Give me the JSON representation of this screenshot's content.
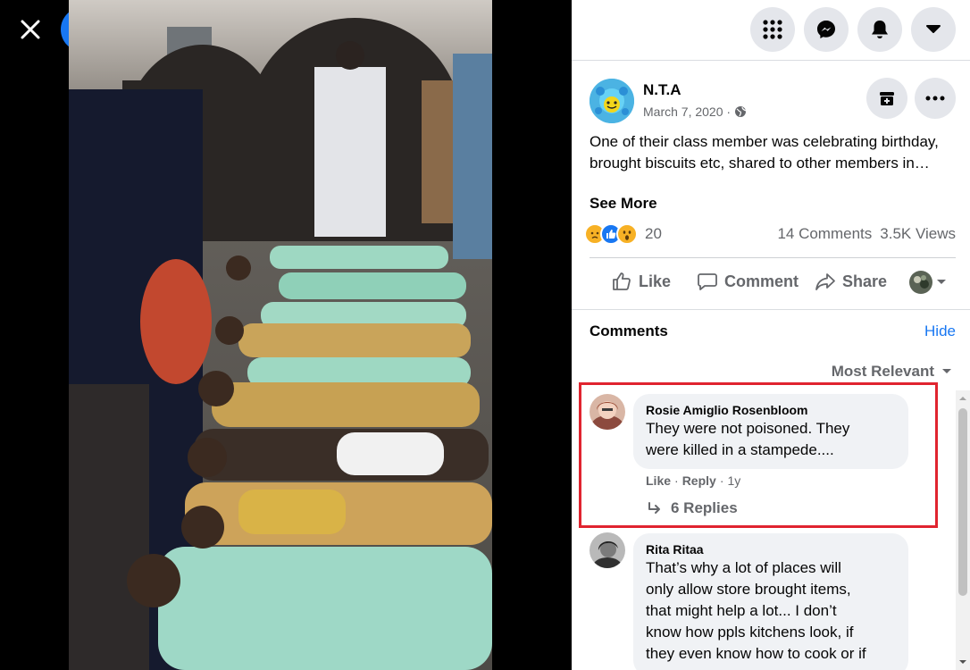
{
  "viewer": {
    "close_icon": "close-icon",
    "logo_icon": "facebook-logo-icon"
  },
  "topbar": {
    "buttons": [
      "apps-grid-icon",
      "messenger-icon",
      "notifications-bell-icon",
      "account-dropdown-icon"
    ]
  },
  "post": {
    "page_name": "N.T.A",
    "date": "March 7, 2020 ·",
    "audience_icon": "globe-icon",
    "text": "One of their class member was celebrating birthday, brought biscuits etc, shared to other members in…",
    "see_more": "See More",
    "reaction_icons": [
      "sad-reaction-icon",
      "like-reaction-icon",
      "wow-reaction-icon"
    ],
    "reaction_count": "20",
    "comments_count": "14 Comments",
    "views_count": "3.5K Views"
  },
  "actions": {
    "like": "Like",
    "comment": "Comment",
    "share": "Share"
  },
  "comments": {
    "heading": "Comments",
    "hide": "Hide",
    "sort": "Most Relevant",
    "items": [
      {
        "author": "Rosie Amiglio Rosenbloom",
        "text_line1": "They were not poisoned. They",
        "text_line2": "were killed in a stampede....",
        "like": "Like",
        "reply": "Reply",
        "age": "1y",
        "replies": "6 Replies"
      },
      {
        "author": "Rita Ritaa",
        "text_line1": "That’s why a lot of places will",
        "text_line2": "only allow store brought items,",
        "text_line3": "that might help a lot... I don’t",
        "text_line4": "know how ppls kitchens look, if",
        "text_line5": "they even know how to cook or if"
      }
    ]
  },
  "colors": {
    "accent": "#1877f2",
    "highlight": "#e0242f",
    "secondary_text": "#65676b"
  }
}
